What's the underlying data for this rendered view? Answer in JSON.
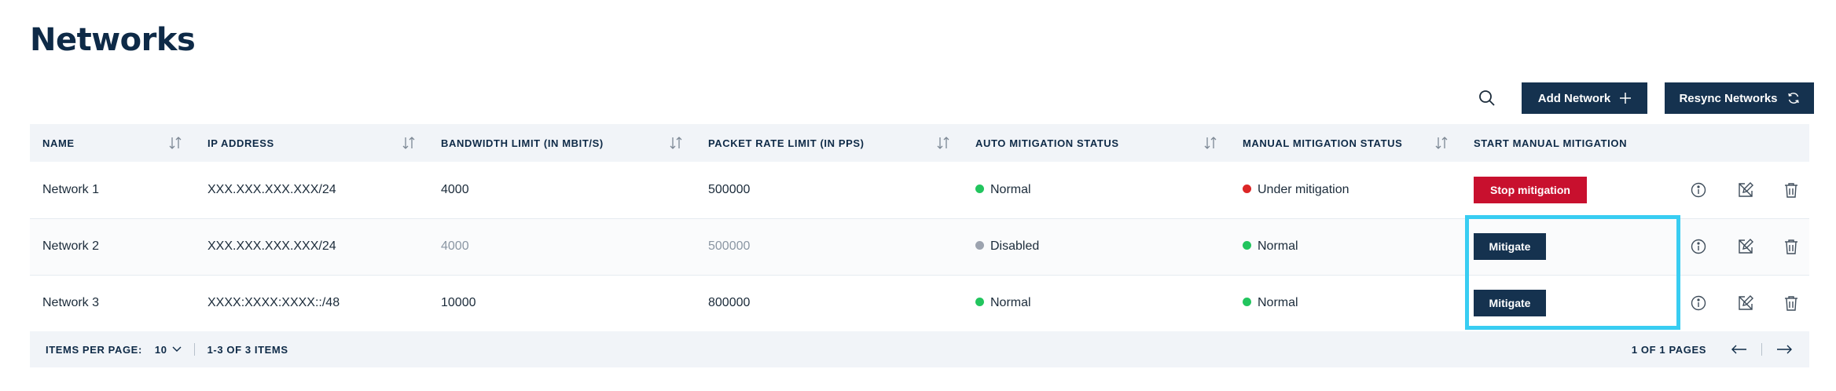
{
  "page": {
    "title": "Networks"
  },
  "toolbar": {
    "search_icon": "search-icon",
    "add_label": "Add Network",
    "add_icon": "plus-icon",
    "resync_label": "Resync Networks",
    "resync_icon": "refresh-icon"
  },
  "table": {
    "headers": [
      "Name",
      "IP Address",
      "Bandwidth limit (in Mbit/s)",
      "Packet rate limit (in pps)",
      "Auto mitigation status",
      "Manual mitigation status",
      "Start manual mitigation"
    ],
    "rows": [
      {
        "name": "Network 1",
        "ip": "XXX.XXX.XXX.XXX/24",
        "bandwidth": "4000",
        "packet_rate": "500000",
        "auto_status": "Normal",
        "manual_status": "Under mitigation",
        "action": "Stop mitigation"
      },
      {
        "name": "Network 2",
        "ip": "XXX.XXX.XXX.XXX/24",
        "bandwidth": "4000",
        "packet_rate": "500000",
        "auto_status": "Disabled",
        "manual_status": "Normal",
        "action": "Mitigate"
      },
      {
        "name": "Network 3",
        "ip": "XXXX:XXXX:XXXX::/48",
        "bandwidth": "10000",
        "packet_rate": "800000",
        "auto_status": "Normal",
        "manual_status": "Normal",
        "action": "Mitigate"
      }
    ]
  },
  "colors": {
    "status_normal": "#22c55e",
    "status_disabled": "#9ca3af",
    "status_under_mitigation": "#dc2626",
    "stop_button": "#c8102e",
    "primary": "#15324f",
    "highlight": "#38cdf2"
  },
  "footer": {
    "items_per_page_label": "Items per page:",
    "items_per_page_value": "10",
    "range": "1-3 of 3 items",
    "pages": "1 of 1 pages"
  }
}
